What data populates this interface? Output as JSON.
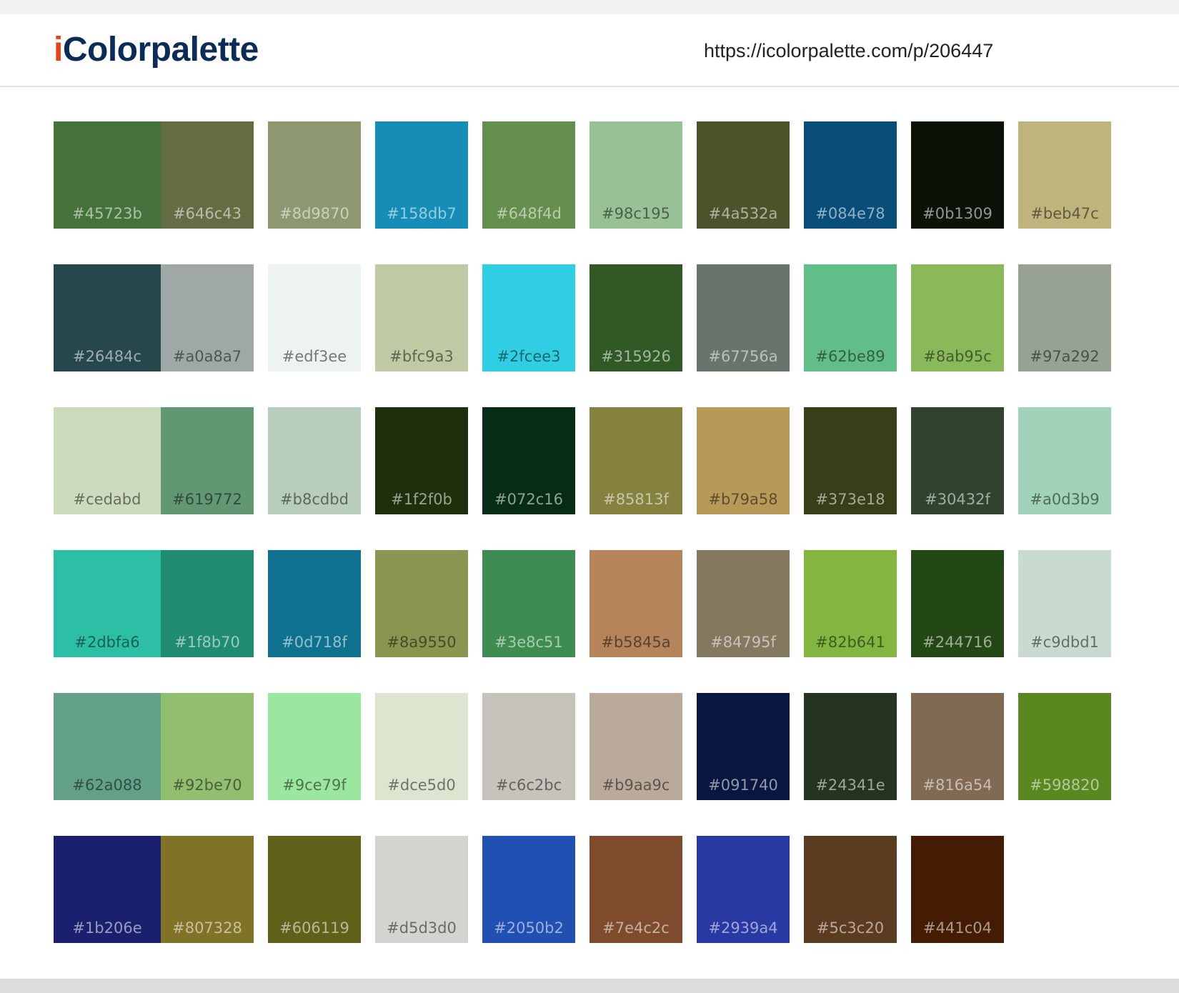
{
  "header": {
    "logo_i": "i",
    "logo_rest": "Colorpalette",
    "url": "https://icolorpalette.com/p/206447"
  },
  "swatches": [
    {
      "hex": "#45723b",
      "label": "#45723b",
      "light": false
    },
    {
      "hex": "#646c43",
      "label": "#646c43",
      "light": false
    },
    {
      "hex": "#8d9870",
      "label": "#8d9870",
      "light": false
    },
    {
      "hex": "#158db7",
      "label": "#158db7",
      "light": false
    },
    {
      "hex": "#648f4d",
      "label": "#648f4d",
      "light": false
    },
    {
      "hex": "#98c195",
      "label": "#98c195",
      "light": true
    },
    {
      "hex": "#4a532a",
      "label": "#4a532a",
      "light": false
    },
    {
      "hex": "#084e78",
      "label": "#084e78",
      "light": false
    },
    {
      "hex": "#0b1309",
      "label": "#0b1309",
      "light": false
    },
    {
      "hex": "#beb47c",
      "label": "#beb47c",
      "light": true
    },
    {
      "hex": "#26484c",
      "label": "#26484c",
      "light": false
    },
    {
      "hex": "#a0a8a7",
      "label": "#a0a8a7",
      "light": true
    },
    {
      "hex": "#edf3ee",
      "label": "#edf3ee",
      "light": true
    },
    {
      "hex": "#bfc9a3",
      "label": "#bfc9a3",
      "light": true
    },
    {
      "hex": "#2fcee3",
      "label": "#2fcee3",
      "light": true
    },
    {
      "hex": "#315926",
      "label": "#315926",
      "light": false
    },
    {
      "hex": "#67756a",
      "label": "#67756a",
      "light": false
    },
    {
      "hex": "#62be89",
      "label": "#62be89",
      "light": true
    },
    {
      "hex": "#8ab95c",
      "label": "#8ab95c",
      "light": true
    },
    {
      "hex": "#97a292",
      "label": "#97a292",
      "light": true
    },
    {
      "hex": "#cedabd",
      "label": "#cedabd",
      "light": true
    },
    {
      "hex": "#619772",
      "label": "#619772",
      "light": true
    },
    {
      "hex": "#b8cdbd",
      "label": "#b8cdbd",
      "light": true
    },
    {
      "hex": "#1f2f0b",
      "label": "#1f2f0b",
      "light": false
    },
    {
      "hex": "#072c16",
      "label": "#072c16",
      "light": false
    },
    {
      "hex": "#85813f",
      "label": "#85813f",
      "light": false
    },
    {
      "hex": "#b79a58",
      "label": "#b79a58",
      "light": true
    },
    {
      "hex": "#373e18",
      "label": "#373e18",
      "light": false
    },
    {
      "hex": "#30432f",
      "label": "#30432f",
      "light": false
    },
    {
      "hex": "#a0d3b9",
      "label": "#a0d3b9",
      "light": true
    },
    {
      "hex": "#2dbfa6",
      "label": "#2dbfa6",
      "light": true
    },
    {
      "hex": "#1f8b70",
      "label": "#1f8b70",
      "light": false
    },
    {
      "hex": "#0d718f",
      "label": "#0d718f",
      "light": false
    },
    {
      "hex": "#8a9550",
      "label": "#8a9550",
      "light": true
    },
    {
      "hex": "#3e8c51",
      "label": "#3e8c51",
      "light": false
    },
    {
      "hex": "#b5845a",
      "label": "#b5845a",
      "light": true
    },
    {
      "hex": "#84795f",
      "label": "#84795f",
      "light": false
    },
    {
      "hex": "#82b641",
      "label": "#82b641",
      "light": true
    },
    {
      "hex": "#244716",
      "label": "#244716",
      "light": false
    },
    {
      "hex": "#c9dbd1",
      "label": "#c9dbd1",
      "light": true
    },
    {
      "hex": "#62a088",
      "label": "#62a088",
      "light": true
    },
    {
      "hex": "#92be70",
      "label": "#92be70",
      "light": true
    },
    {
      "hex": "#9ce79f",
      "label": "#9ce79f",
      "light": true
    },
    {
      "hex": "#dce5d0",
      "label": "#dce5d0",
      "light": true
    },
    {
      "hex": "#c6c2bc",
      "label": "#c6c2bc",
      "light": true
    },
    {
      "hex": "#b9aa9c",
      "label": "#b9aa9c",
      "light": true
    },
    {
      "hex": "#091740",
      "label": "#091740",
      "light": false
    },
    {
      "hex": "#24341e",
      "label": "#24341e",
      "light": false
    },
    {
      "hex": "#816a54",
      "label": "#816a54",
      "light": false
    },
    {
      "hex": "#598820",
      "label": "#598820",
      "light": false
    },
    {
      "hex": "#1b206e",
      "label": "#1b206e",
      "light": false
    },
    {
      "hex": "#807328",
      "label": "#807328",
      "light": false
    },
    {
      "hex": "#606119",
      "label": "#606119",
      "light": false
    },
    {
      "hex": "#d5d3d0",
      "label": "#d5d3d0",
      "light": true
    },
    {
      "hex": "#2050b2",
      "label": "#2050b2",
      "light": false
    },
    {
      "hex": "#7e4c2c",
      "label": "#7e4c2c",
      "light": false
    },
    {
      "hex": "#2939a4",
      "label": "#2939a4",
      "light": false
    },
    {
      "hex": "#5c3c20",
      "label": "#5c3c20",
      "light": false
    },
    {
      "hex": "#441c04",
      "label": "#441c04",
      "light": false
    }
  ]
}
